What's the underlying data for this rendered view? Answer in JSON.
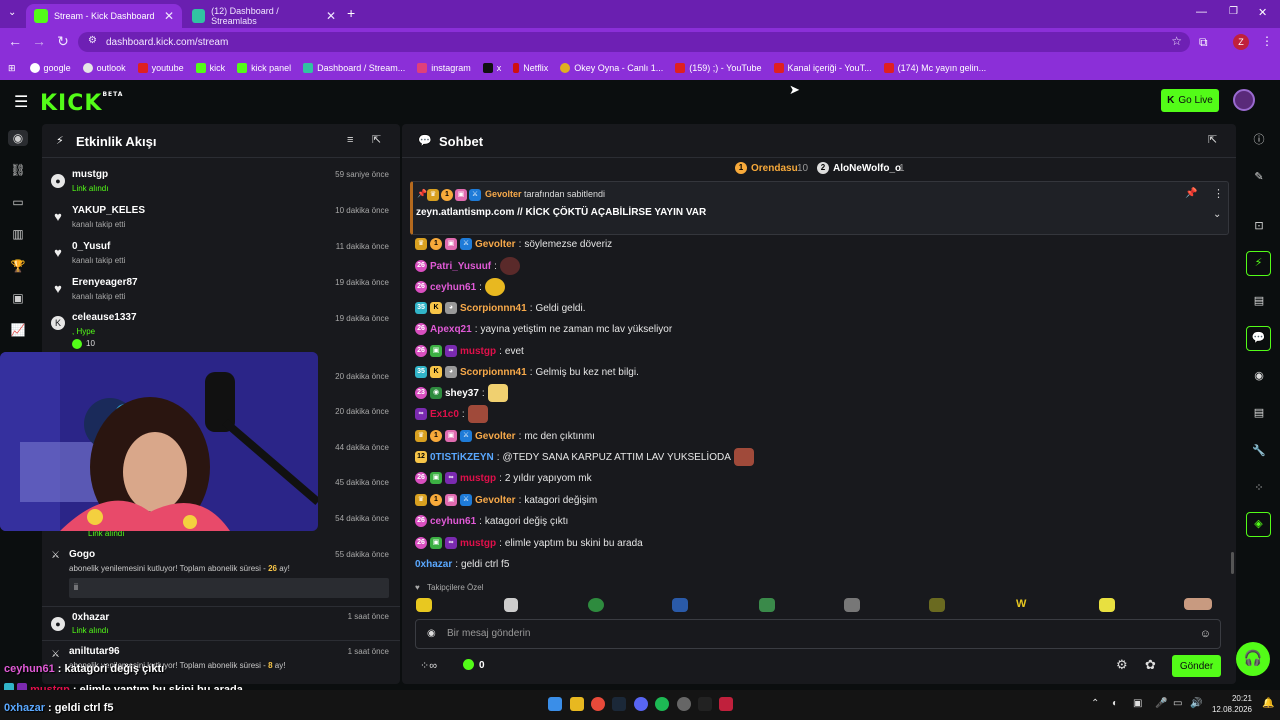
{
  "browser": {
    "tabs": [
      {
        "title": "Stream - Kick Dashboard",
        "active": true
      },
      {
        "title": "(12) Dashboard / Streamlabs",
        "active": false
      }
    ],
    "url": "dashboard.kick.com/stream",
    "bookmarks": [
      "google",
      "outlook",
      "youtube",
      "kick",
      "kick panel",
      "Dashboard / Stream...",
      "instagram",
      "x",
      "Netflix",
      "Okey Oyna - Canlı 1...",
      "(159) ;) - YouTube",
      "Kanal içeriği - YouT...",
      "(174) Mc yayın gelin..."
    ],
    "profile_initial": "Z"
  },
  "header": {
    "logo": "KICK",
    "logo_beta": "BETA",
    "go_live": "Go Live"
  },
  "activity": {
    "title": "Etkinlik Akışı",
    "items": [
      {
        "user": "mustgp",
        "sub": "Link alındı",
        "time": "59 saniye önce"
      },
      {
        "user": "YAKUP_KELES",
        "sub": "kanalı takip etti",
        "time": "10 dakika önce"
      },
      {
        "user": "0_Yusuf",
        "sub": "kanalı takip etti",
        "time": "11 dakika önce"
      },
      {
        "user": "Erenyeager87",
        "sub": "kanalı takip etti",
        "time": "19 dakika önce"
      },
      {
        "user": "celeause1337",
        "sub": ", Hype",
        "count": "10",
        "time": "19 dakika önce"
      }
    ],
    "hidden_times": [
      "20 dakika önce",
      "20 dakika önce",
      "44 dakika önce",
      "45 dakika önce",
      "54 dakika önce"
    ],
    "hidden_sub": "Link alındı",
    "gogo": {
      "user": "Gogo",
      "time": "55 dakika önce",
      "sub_prefix": "abonelik yenilemesini kutluyor! Toplam abonelik süresi - ",
      "months": "26",
      "sub_suffix": " ay!",
      "note": "ii"
    },
    "oxhazar": {
      "user": "0xhazar",
      "sub": "Link alındı",
      "time": "1 saat önce"
    },
    "anilturar": {
      "user": "aniltutar96",
      "time": "1 saat önce",
      "sub_prefix": "abonelik yenilemesini kutluyor! Toplam abonelik süresi - ",
      "months": "8",
      "sub_suffix": " ay!"
    }
  },
  "chat": {
    "title": "Sohbet",
    "leaders": [
      {
        "rank": "1",
        "name": "Orendasu",
        "count": "10"
      },
      {
        "rank": "2",
        "name": "AloNeWolfo_o",
        "count": "1"
      }
    ],
    "pinned": {
      "by_user": "Gevolter",
      "by_label": "tarafından sabitlendi",
      "text": "zeyn.atlantismp.com // KİCK ÇÖKTÜ AÇABİLİRSE YAYIN VAR"
    },
    "messages": [
      {
        "user": "Gevolter",
        "color": "#f7a94a",
        "text": "söylemezse döveriz"
      },
      {
        "user": "Patri_Yusuuf",
        "color": "#e05ad6",
        "text": ""
      },
      {
        "user": "ceyhun61",
        "color": "#e05ad6",
        "text": ""
      },
      {
        "user": "Scorpionnn41",
        "color": "#f7a94a",
        "text": "Geldi geldi."
      },
      {
        "user": "Apexq21",
        "color": "#e05ad6",
        "text": "yayına yetiştim ne zaman mc lav yükseliyor"
      },
      {
        "user": "mustgp",
        "color": "#e0104b",
        "text": "evet"
      },
      {
        "user": "Scorpionnn41",
        "color": "#f7a94a",
        "text": "Gelmiş bu kez net bilgi."
      },
      {
        "user": "shey37",
        "color": "#ffffff",
        "text": ""
      },
      {
        "user": "Ex1c0",
        "color": "#e0104b",
        "text": ""
      },
      {
        "user": "Gevolter",
        "color": "#f7a94a",
        "text": "mc den çıktınmı"
      },
      {
        "user": "0TISTiKZEYN",
        "color": "#5aa8ff",
        "text": "@TEDY SANA KARPUZ ATTIM LAV YUKSELİODA"
      },
      {
        "user": "mustgp",
        "color": "#e0104b",
        "text": "2 yıldır yapıyom mk"
      },
      {
        "user": "Gevolter",
        "color": "#f7a94a",
        "text": "katagori değişim"
      },
      {
        "user": "ceyhun61",
        "color": "#e05ad6",
        "text": "katagori değiş çıktı"
      },
      {
        "user": "mustgp",
        "color": "#e0104b",
        "text": "elimle yaptım bu skini bu arada"
      },
      {
        "user": "0xhazar",
        "color": "#5aa8ff",
        "text": "geldi ctrl f5"
      }
    ],
    "followers_only": "Takipçilere Özel",
    "input_placeholder": "Bir mesaj gönderin",
    "points": "0",
    "send": "Gönder"
  },
  "overlay": [
    {
      "user": "ceyhun61",
      "text": "katagori değiş çıktı"
    },
    {
      "user": "mustgp",
      "text": "elimle yaptım bu skini bu arada"
    },
    {
      "user": "0xhazar",
      "text": "geldi ctrl f5"
    }
  ],
  "taskbar": {
    "time": "20:21",
    "date": "12.08.2026"
  }
}
